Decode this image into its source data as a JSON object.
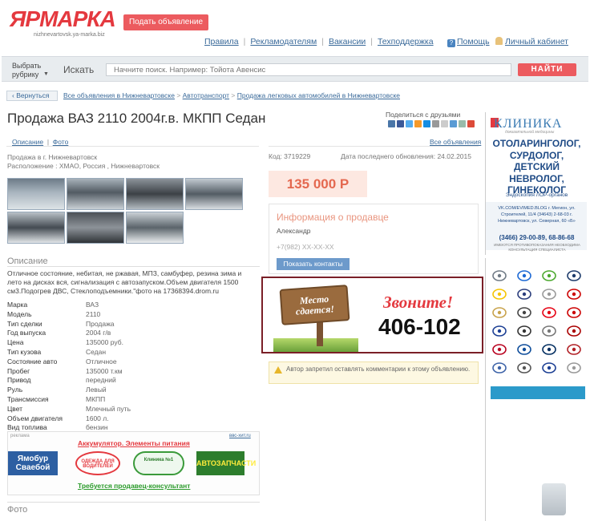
{
  "header": {
    "logo": "ЯРМАРКА",
    "logo_sub": "nizhnevartovsk.ya-marka.biz",
    "post_button": "Подать объявление",
    "nav": [
      "Правила",
      "Рекламодателям",
      "Вакансии",
      "Техподдержка"
    ],
    "help": "Помощь",
    "cabinet": "Личный кабинет"
  },
  "search": {
    "rubric_line1": "Выбрать",
    "rubric_line2": "рубрику",
    "label": "Искать",
    "placeholder": "Начните поиск. Например: Тойота Авенсис",
    "button": "НАЙТИ"
  },
  "breadcrumb": {
    "back": "Вернуться",
    "items": [
      "Все объявления в Нижневартовске",
      "Автотранспорт",
      "Продажа легковых автомобилей в Нижневартовске"
    ]
  },
  "listing": {
    "title": "Продажа ВАЗ 2110 2004г.в. МКПП Седан",
    "share_label": "Поделиться с друзьями",
    "tabs": [
      "Описание",
      "Фото"
    ],
    "all_ads": "Все объявления",
    "location_line1": "Продажа в г. Нижневартовск",
    "location_line2": "Расположение : ХМАО, Россия , Нижневартовск",
    "code": "Код: 3719229",
    "updated": "Дата последнего обновления: 24.02.2015",
    "price": "135 000 Р",
    "description_heading": "Описание",
    "description": "Отличное состояние, небитая, не ржавая, МПЗ, самбуфер, резина зима и лето на дисках вся, сигнализация с автозапуском.Объем двигателя 1500 см3.Подогрев ДВС, Стеклоподъемники.\"фото на 17368394.drom.ru",
    "photo_heading": "Фото",
    "specs": [
      {
        "k": "Марка",
        "v": "ВАЗ"
      },
      {
        "k": "Модель",
        "v": "2110"
      },
      {
        "k": "Тип сделки",
        "v": "Продажа"
      },
      {
        "k": "Год выпуска",
        "v": "2004 г/в"
      },
      {
        "k": "Цена",
        "v": "135000 руб."
      },
      {
        "k": "Тип кузова",
        "v": "Седан"
      },
      {
        "k": "Состояние авто",
        "v": "Отличное"
      },
      {
        "k": "Пробег",
        "v": "135000 т.км"
      },
      {
        "k": "Привод",
        "v": "передний"
      },
      {
        "k": "Руль",
        "v": "Левый"
      },
      {
        "k": "Трансмиссия",
        "v": "МКПП"
      },
      {
        "k": "Цвет",
        "v": "Млечный путь"
      },
      {
        "k": "Объем двигателя",
        "v": "1600 л."
      },
      {
        "k": "Вид топлива",
        "v": "бензин"
      }
    ]
  },
  "seller": {
    "heading": "Информация о продавце",
    "name": "Александр",
    "phone": "+7(982) XX-XX-XX",
    "button": "Показать контакты"
  },
  "banner": {
    "sign": "Место сдается!",
    "call": "Звоните!",
    "phone": "406-102"
  },
  "notice": "Автор запретил оставлять комментарии к этому объявлению.",
  "ad_block": {
    "label": "реклама",
    "link": "ввс-хит.ru",
    "title": "Аккумулятор. Элементы питания",
    "ad1": "Ямобур Свaебой",
    "ad2": "ОДЕЖДА ДЛЯ ВОДИТЕЛЕЙ",
    "ad3": "Клиника №1",
    "ad4": "АВТОЗАПЧАСТИ",
    "footer": "Требуется продавец-консультант"
  },
  "clinic": {
    "logo": "КЛИНИКА",
    "sub": "доказательной медицины",
    "specialties": [
      "ОТОЛАРИНГОЛОГ,",
      "СУРДОЛОГ,",
      "ДЕТСКИЙ",
      "НЕВРОЛОГ,",
      "ГИНЕКОЛОГ"
    ],
    "endo": "Эндоскопия ЛОР-органов",
    "address": "VK.COM/EVIMED.BLOG г. Мегион, ул. Строителей, 11/4 (34643) 2-68-03 г. Нижневартовск, ул. Северная, 60 «Б»",
    "phone": "(3466) 29-00-89, 68-86-68",
    "warning": "ИМЕЮТСЯ ПРОТИВОПОКАЗАНИЯ НЕОБХОДИМА КОНСУЛЬТАЦИЯ СПЕЦИАЛИСТА"
  },
  "brands": [
    "Renault",
    "BMW",
    "Skoda",
    "VW",
    "Opel",
    "Peugeot",
    "Citroen",
    "Toyota",
    "Chevrolet",
    "Lexus",
    "Mitsubishi",
    "Honda",
    "Ford",
    "Mazda",
    "Nissan",
    "Chery",
    "Kia",
    "Suzuki",
    "Hyundai",
    "Lada",
    "Geely",
    "Infiniti",
    "Subaru",
    "Audi"
  ]
}
